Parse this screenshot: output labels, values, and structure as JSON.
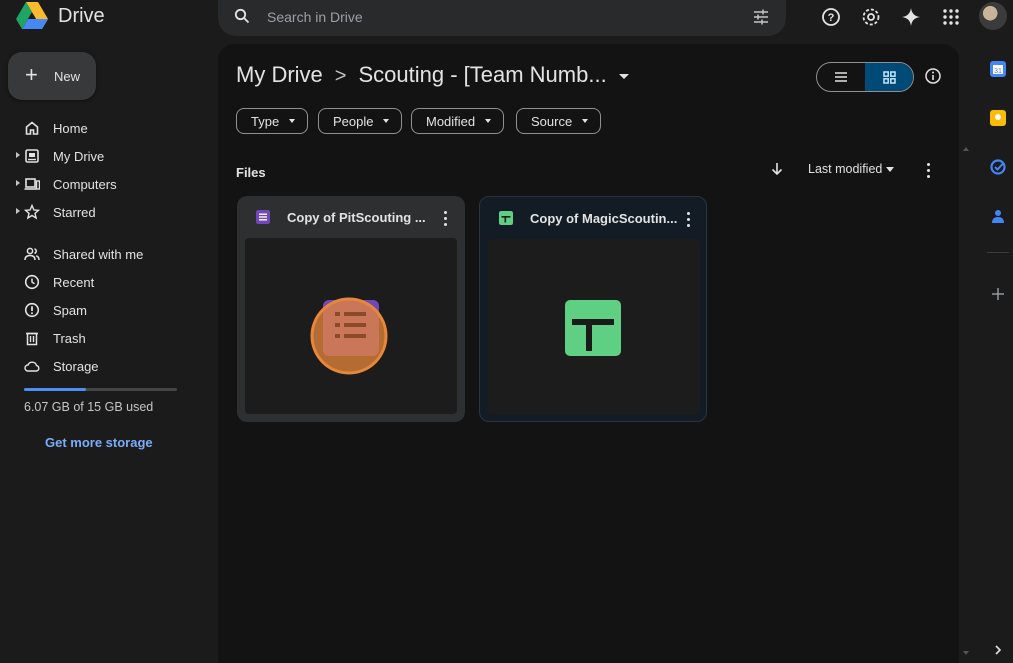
{
  "app": {
    "brand": "Drive"
  },
  "search": {
    "placeholder": "Search in Drive"
  },
  "sidebar": {
    "new_label": "New",
    "items": [
      {
        "label": "Home",
        "icon": "home-icon",
        "expandable": false
      },
      {
        "label": "My Drive",
        "icon": "my-drive-icon",
        "expandable": true
      },
      {
        "label": "Computers",
        "icon": "computer-icon",
        "expandable": true
      },
      {
        "label": "Starred",
        "icon": "star-icon",
        "expandable": true
      },
      {
        "label": "Shared with me",
        "icon": "shared-icon",
        "expandable": false
      },
      {
        "label": "Recent",
        "icon": "clock-icon",
        "expandable": false
      },
      {
        "label": "Spam",
        "icon": "spam-icon",
        "expandable": false
      },
      {
        "label": "Trash",
        "icon": "trash-icon",
        "expandable": false
      },
      {
        "label": "Storage",
        "icon": "cloud-icon",
        "expandable": false
      }
    ],
    "storage_used_fraction": 0.405,
    "storage_text": "6.07 GB of 15 GB used",
    "get_more": "Get more storage"
  },
  "breadcrumb": {
    "root": "My Drive",
    "sep": ">",
    "current": "Scouting - [Team Numb..."
  },
  "filters": [
    "Type",
    "People",
    "Modified",
    "Source"
  ],
  "files_section": {
    "label": "Files",
    "sort_label": "Last modified"
  },
  "files": [
    {
      "name": "Copy of PitScouting ...",
      "kind": "forms",
      "color": "#7248b9"
    },
    {
      "name": "Copy of MagicScoutin...",
      "kind": "sheets",
      "color": "#5fcf84"
    }
  ],
  "colors": {
    "accent": "#7cacf8",
    "highlight": "#e8873a",
    "selected_toggle": "#004a77"
  }
}
